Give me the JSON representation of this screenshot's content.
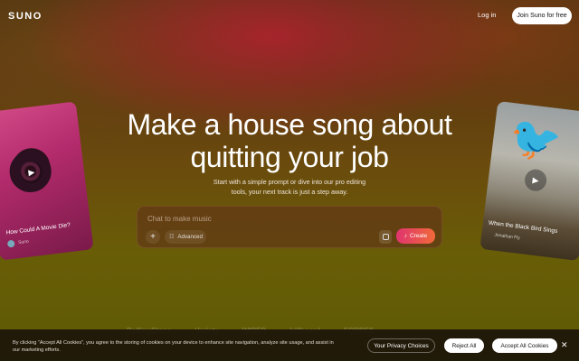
{
  "header": {
    "logo": "SUNO",
    "login_label": "Log in",
    "join_label": "Join Suno for free"
  },
  "hero": {
    "headline_line1": "Make a house song about",
    "headline_line2": "quitting your job",
    "subtitle_line1": "Start with a simple prompt or dive into our pro editing",
    "subtitle_line2": "tools, your next track is just a step away."
  },
  "prompt": {
    "placeholder": "Chat to make music",
    "plus_label": "+",
    "advanced_label": "Advanced",
    "create_label": "Create"
  },
  "cards": {
    "left": {
      "title": "How Could A Movie Die?",
      "artist": "Suno"
    },
    "right": {
      "title": "When the Black Bird Sings",
      "artist": "Jonathan Fly"
    }
  },
  "press_logos": [
    "RollingStone",
    "Variety",
    "WIRED",
    "billboard",
    "FORBES"
  ],
  "cookie": {
    "text": "By clicking “Accept All Cookies”, you agree to the storing of cookies on your device to enhance site navigation, analyze site usage, and assist in our marketing efforts.",
    "privacy_label": "Your Privacy Choices",
    "reject_label": "Reject All",
    "accept_label": "Accept All Cookies",
    "close_label": "✕"
  },
  "colors": {
    "create_gradient_start": "#e0346f",
    "create_gradient_end": "#f06a3a"
  }
}
